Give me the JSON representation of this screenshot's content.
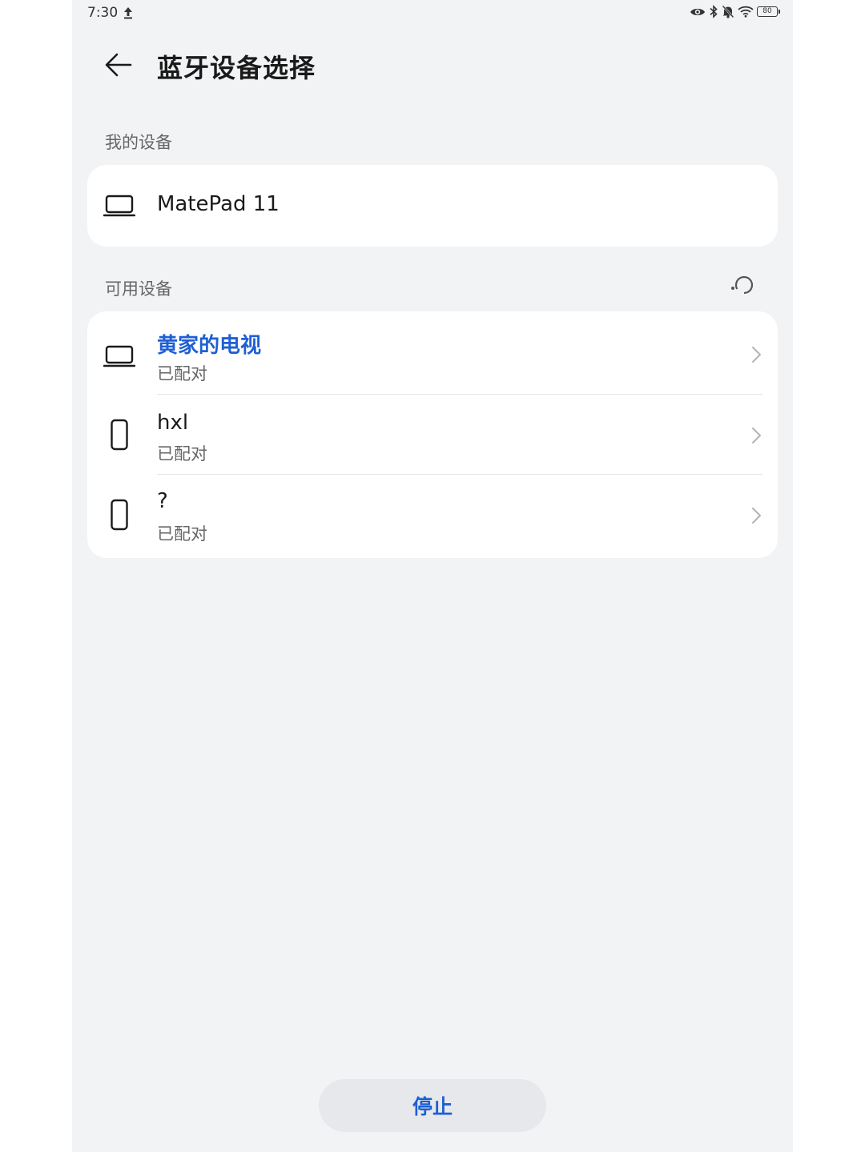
{
  "status_bar": {
    "time": "7:30",
    "battery": "80",
    "icons": [
      "upload-arrow-icon",
      "eye-icon",
      "bluetooth-icon",
      "bell-muted-icon",
      "wifi-icon",
      "battery-icon"
    ]
  },
  "header": {
    "title": "蓝牙设备选择",
    "back_icon": "arrow-left-icon"
  },
  "my_devices": {
    "label": "我的设备",
    "items": [
      {
        "name": "MatePad 11",
        "icon": "laptop-icon"
      }
    ]
  },
  "available_devices": {
    "label": "可用设备",
    "refresh_icon": "scanning-icon",
    "items": [
      {
        "name": "黄家的电视",
        "status": "已配对",
        "icon": "laptop-icon",
        "highlighted": true
      },
      {
        "name": "hxl",
        "status": "已配对",
        "icon": "phone-icon",
        "highlighted": false
      },
      {
        "name": "?",
        "status": "已配对",
        "icon": "phone-icon",
        "highlighted": false
      }
    ]
  },
  "stop_button": {
    "label": "停止"
  },
  "colors": {
    "accent": "#1f5fd4",
    "background": "#f1f3f5",
    "card": "#ffffff"
  }
}
